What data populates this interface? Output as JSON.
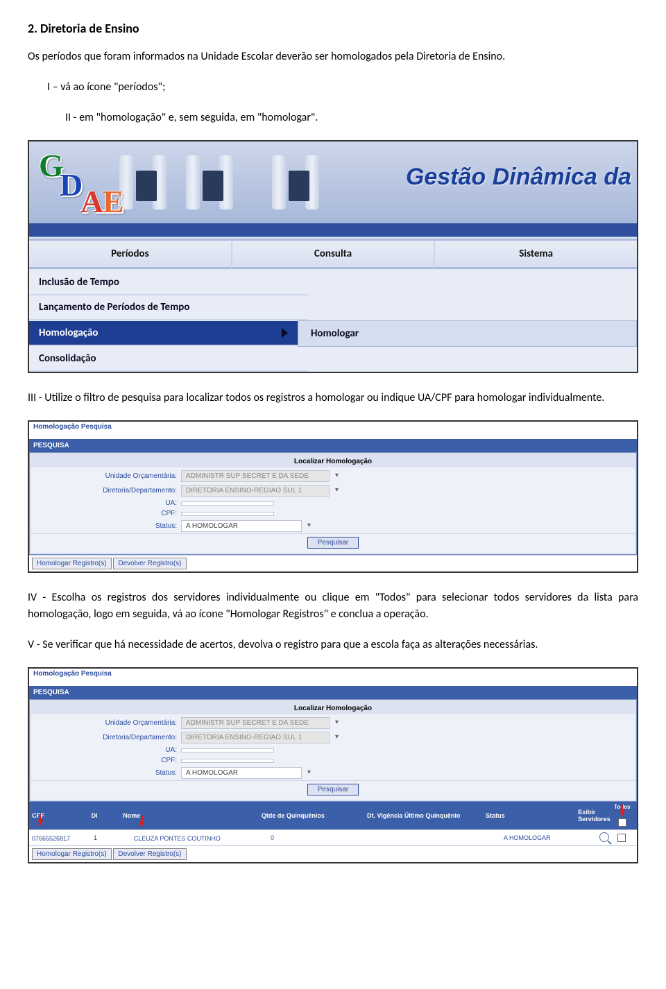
{
  "doc": {
    "section_title": "2.  Diretoria de Ensino",
    "p1": "Os períodos que foram informados na Unidade Escolar deverão ser homologados pela Diretoria de Ensino.",
    "p2": "I – vá ao ícone \"períodos\";",
    "p3": "II -  em \"homologação\" e, sem seguida, em \"homologar\".",
    "p4": "III - Utilize o filtro de pesquisa para localizar todos os registros a homologar ou indique UA/CPF para homologar individualmente.",
    "p5": "IV - Escolha os registros dos servidores individualmente ou clique em \"Todos\" para selecionar todos servidores da lista para homologação, logo em seguida, vá ao ícone \"Homologar Registros\" e conclua a operação.",
    "p6": "V - Se verificar que há necessidade de acertos, devolva o registro para que a escola faça as alterações necessárias."
  },
  "shot1": {
    "logo": {
      "G": "G",
      "D": "D",
      "A": "A",
      "E": "E"
    },
    "banner_title": "Gestão Dinâmica da",
    "tabs": [
      "Períodos",
      "Consulta",
      "Sistema"
    ],
    "menu": {
      "item1": "Inclusão de Tempo",
      "item2": "Lançamento de Períodos de Tempo",
      "item3": "Homologação",
      "submenu": "Homologar",
      "item4": "Consolidação"
    }
  },
  "shot2": {
    "crumb": "Homologação Pesquisa",
    "bluebar": "PESQUISA",
    "title": "Localizar Homologação",
    "labels": {
      "unidade": "Unidade Orçamentária:",
      "diretoria": "Diretoria/Departamento:",
      "ua": "UA:",
      "cpf": "CPF:",
      "status": "Status:"
    },
    "values": {
      "unidade": "ADMINISTR SUP SECRET E DA SEDE",
      "diretoria": "DIRETORIA ENSINO-REGIAO SUL 1",
      "ua": "",
      "cpf": "",
      "status": "A HOMOLOGAR"
    },
    "btn_pesquisar": "Pesquisar",
    "btn_homologar": "Homologar Registro(s)",
    "btn_devolver": "Devolver Registro(s)"
  },
  "shot4": {
    "crumb": "Homologação Pesquisa",
    "bluebar": "PESQUISA",
    "title": "Localizar Homologação",
    "labels": {
      "unidade": "Unidade Orçamentária:",
      "diretoria": "Diretoria/Departamento:",
      "ua": "UA:",
      "cpf": "CPF:",
      "status": "Status:"
    },
    "values": {
      "unidade": "ADMINISTR SUP SECRET E DA SEDE",
      "diretoria": "DIRETORIA ENSINO-REGIAO SUL 1",
      "ua": "",
      "cpf": "",
      "status": "A HOMOLOGAR"
    },
    "btn_pesquisar": "Pesquisar",
    "headers": {
      "cpf": "CPF",
      "di": "DI",
      "nome": "Nome",
      "qtde": "Qtde de Quinquênios",
      "vig": "Dt. Vigência Último Quinquênio",
      "status": "Status",
      "exibir": "Exibir Servidores",
      "todos": "Todos"
    },
    "row": {
      "cpf": "07665526817",
      "di": "1",
      "nome": "CLEUZA PONTES COUTINHO",
      "qtde": "0",
      "vig": "",
      "status": "A HOMOLOGAR"
    },
    "btn_homologar": "Homologar Registro(s)",
    "btn_devolver": "Devolver Registro(s)"
  }
}
